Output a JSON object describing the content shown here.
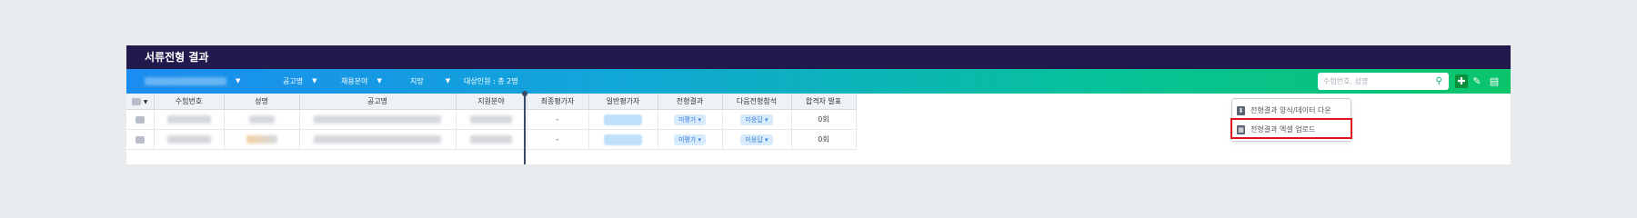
{
  "header": {
    "title": "서류전형 결과"
  },
  "toolbar": {
    "filters": [
      {
        "label": "공고명"
      },
      {
        "label": "채용분야"
      },
      {
        "label": "지망"
      }
    ],
    "target_count": "대상인원 : 총 2명",
    "search_placeholder": "수험번호, 성명",
    "icons": [
      "add-document-icon",
      "edit-icon",
      "clipboard-icon"
    ]
  },
  "table": {
    "columns": [
      "수험번호",
      "성명",
      "공고명",
      "지원분야",
      "최종평가자",
      "일반평가자",
      "전형결과",
      "다음전형참석",
      "합격자 발표"
    ],
    "rows": [
      {
        "final_evaluator": "-",
        "result": "미평가",
        "next_stage": "미응답",
        "announce": "0회"
      },
      {
        "final_evaluator": "-",
        "result": "미평가",
        "next_stage": "미응답",
        "announce": "0회"
      }
    ]
  },
  "dropdown": {
    "items": [
      {
        "label": "전형결과 양식/데이터 다운",
        "icon": "download-icon"
      },
      {
        "label": "전형결과 엑셀 업로드",
        "icon": "excel-upload-icon"
      }
    ]
  },
  "colors": {
    "title_bar": "#221a4d",
    "toolbar_gradient_start": "#1b8cf0",
    "toolbar_gradient_end": "#0bc46a",
    "highlight": "#e0141e"
  }
}
